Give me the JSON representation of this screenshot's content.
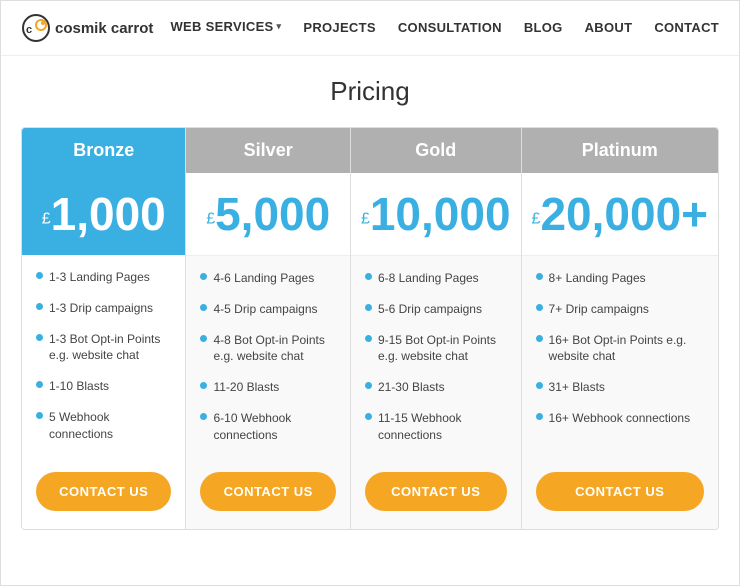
{
  "brand": {
    "name": "cosmik carrot"
  },
  "nav": {
    "links": [
      {
        "label": "WEB SERVICES",
        "dropdown": true
      },
      {
        "label": "PROJECTS",
        "dropdown": false
      },
      {
        "label": "CONSULTATION",
        "dropdown": false
      },
      {
        "label": "BLOG",
        "dropdown": false
      },
      {
        "label": "ABOUT",
        "dropdown": false
      },
      {
        "label": "CONTACT",
        "dropdown": false
      }
    ]
  },
  "page": {
    "title": "Pricing"
  },
  "plans": [
    {
      "id": "bronze",
      "name": "Bronze",
      "currency": "£",
      "price": "1,000",
      "plus": "",
      "features": [
        "1-3 Landing Pages",
        "1-3 Drip campaigns",
        "1-3 Bot Opt-in Points e.g. website chat",
        "1-10 Blasts",
        "5 Webhook connections"
      ],
      "cta": "CONTACT US"
    },
    {
      "id": "silver",
      "name": "Silver",
      "currency": "£",
      "price": "5,000",
      "plus": "",
      "features": [
        "4-6 Landing Pages",
        "4-5 Drip campaigns",
        "4-8 Bot Opt-in Points e.g. website chat",
        "11-20 Blasts",
        "6-10 Webhook connections"
      ],
      "cta": "CONTACT US"
    },
    {
      "id": "gold",
      "name": "Gold",
      "currency": "£",
      "price": "10,000",
      "plus": "",
      "features": [
        "6-8 Landing Pages",
        "5-6 Drip campaigns",
        "9-15 Bot Opt-in Points e.g. website chat",
        "21-30 Blasts",
        "11-15 Webhook connections"
      ],
      "cta": "CONTACT US"
    },
    {
      "id": "platinum",
      "name": "Platinum",
      "currency": "£",
      "price": "20,000+",
      "plus": "",
      "features": [
        "8+ Landing Pages",
        "7+ Drip campaigns",
        "16+ Bot Opt-in Points e.g. website chat",
        "31+ Blasts",
        "16+ Webhook connections"
      ],
      "cta": "CONTACT US"
    }
  ]
}
